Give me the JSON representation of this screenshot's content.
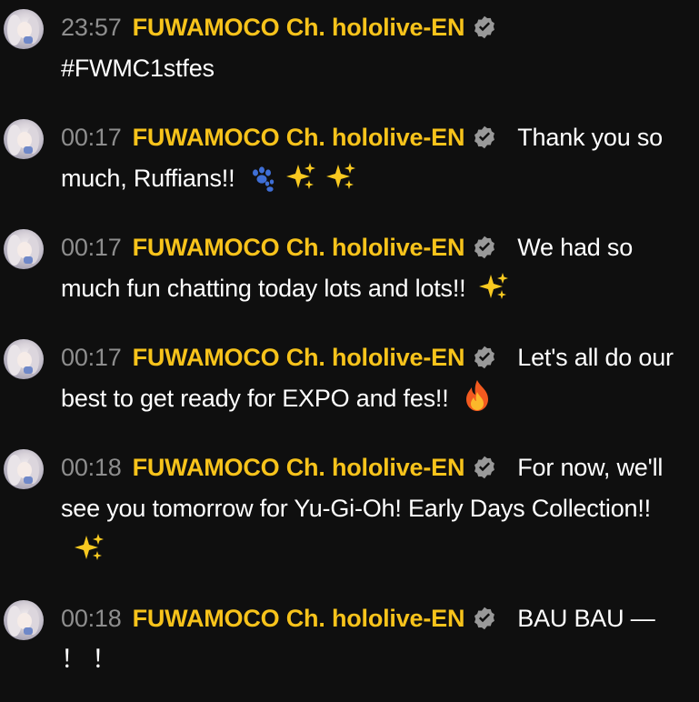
{
  "colors": {
    "background": "#0f0f0f",
    "author": "#f7c31b",
    "timestamp": "#8e8e8e",
    "message": "#ffffff",
    "verified_badge": "#999999"
  },
  "messages": [
    {
      "time": "23:57",
      "author": "FUWAMOCO Ch. hololive-EN",
      "text": "#FWMC1stfes",
      "emojis": []
    },
    {
      "time": "00:17",
      "author": "FUWAMOCO Ch. hololive-EN",
      "text": "Thank you so much, Ruffians!!",
      "emojis": [
        "paw-prints-icon",
        "sparkles-icon",
        "sparkles-icon"
      ]
    },
    {
      "time": "00:17",
      "author": "FUWAMOCO Ch. hololive-EN",
      "text": "We had so much fun chatting today lots and lots!!",
      "emojis": [
        "sparkles-icon"
      ]
    },
    {
      "time": "00:17",
      "author": "FUWAMOCO Ch. hololive-EN",
      "text": "Let's all do our best to get ready for EXPO and fes!!",
      "emojis": [
        "fire-icon"
      ]
    },
    {
      "time": "00:18",
      "author": "FUWAMOCO Ch. hololive-EN",
      "text": "For now, we'll see you tomorrow for Yu-Gi-Oh! Early Days Collection!!",
      "emojis": [
        "sparkles-icon"
      ]
    },
    {
      "time": "00:18",
      "author": "FUWAMOCO Ch. hololive-EN",
      "text": "BAU BAU — ！ ！",
      "emojis": []
    }
  ]
}
